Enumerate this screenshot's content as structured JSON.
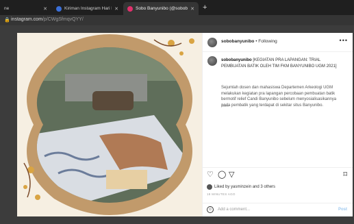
{
  "browser": {
    "tabs": [
      {
        "label": "ne",
        "fav": "#777777"
      },
      {
        "label": "Kiriman Instagram Hari Batik Na",
        "fav": "#3a6fd8"
      },
      {
        "label": "Sobo Banyunibo (@sobobanyun",
        "fav": "#e1306c"
      }
    ],
    "url_host": "instagram.com",
    "url_path": "/p/CWgSfmqvQYY/"
  },
  "post": {
    "username": "sobobanyunibo",
    "separator": "•",
    "follow": "Following",
    "more": "•••",
    "caption_title": "[KEGIATAN PRA LAPANGAN: TRIAL PEMBUATAN BATIK OLEH TIM FKM BANYUNIBO UGM 2021]",
    "caption_body": "Sejumlah dosen dan mahasiswa Departemen Arkeologi UGM melakukan kegiatan pra lapangan percobaan pembuatan batik bermotif relief Candi Banyunibo sebelum menyosialisasikannya pada pembatik yang terdapat di sekitar situs Banyunibo.",
    "caption_time": "20m",
    "likes_text": "Liked by yasminzein and 3 others",
    "time_ago": "18 MINUTES AGO",
    "comment_placeholder": "Add a comment...",
    "post_button": "Post"
  }
}
